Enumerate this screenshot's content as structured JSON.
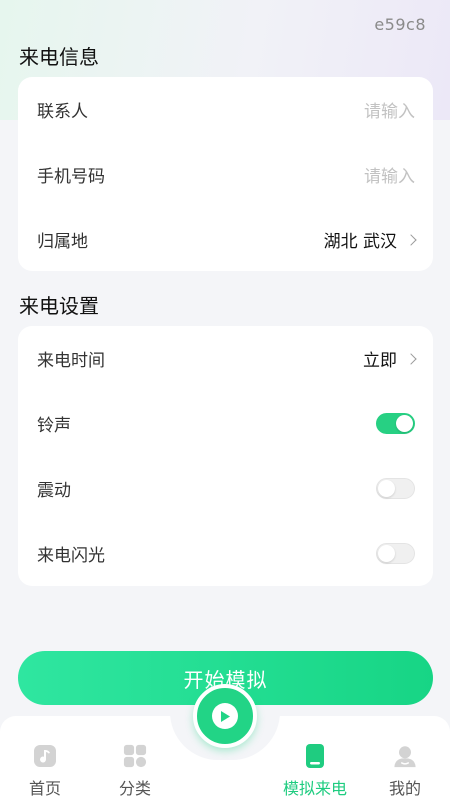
{
  "watermark": "e59c8",
  "call_info": {
    "title": "来电信息",
    "rows": [
      {
        "label": "联系人",
        "placeholder": "请输入"
      },
      {
        "label": "手机号码",
        "placeholder": "请输入"
      },
      {
        "label": "归属地",
        "value": "湖北 武汉"
      }
    ]
  },
  "call_settings": {
    "title": "来电设置",
    "rows": [
      {
        "label": "来电时间",
        "value": "立即"
      },
      {
        "label": "铃声",
        "toggle": true
      },
      {
        "label": "震动",
        "toggle": false
      },
      {
        "label": "来电闪光",
        "toggle": false
      }
    ]
  },
  "start_button": {
    "label": "开始模拟"
  },
  "tabbar": {
    "items": [
      {
        "label": "首页",
        "icon": "music-note-icon",
        "active": false
      },
      {
        "label": "分类",
        "icon": "category-grid-icon",
        "active": false
      },
      {
        "label": "模拟来电",
        "icon": "phone-icon",
        "active": true
      },
      {
        "label": "我的",
        "icon": "user-icon",
        "active": false
      }
    ],
    "center_icon": "play-icon"
  },
  "colors": {
    "accent": "#22d486",
    "background": "#f4f5f8",
    "card": "#ffffff"
  }
}
